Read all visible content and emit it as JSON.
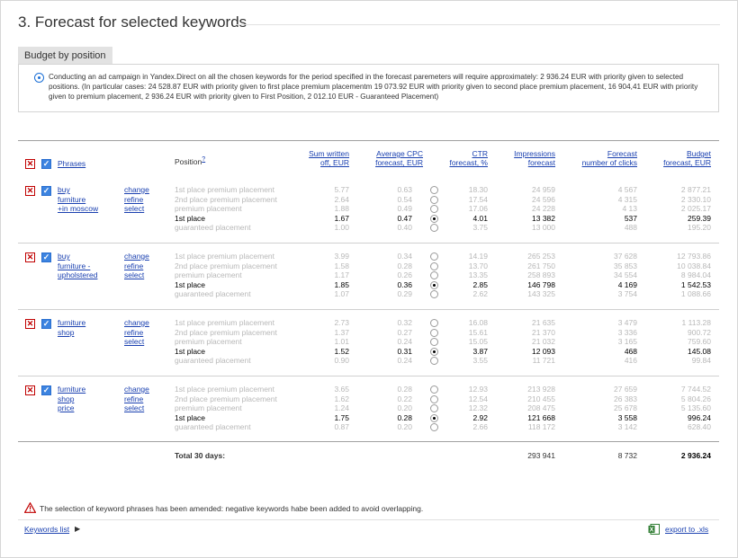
{
  "page": {
    "title": "3. Forecast for selected keywords",
    "tab_label": "Budget by position",
    "info_text": "Conducting an ad campaign in Yandex.Direct on all the chosen keywords for the period specified in the forecast paremeters will require approximately: 2 936.24 EUR with priority given to selected positions. (In particular cases: 24 528.87 EUR with priority given to first place premium placementm 19 073.92 EUR with priority given to second place premium placement, 16 904,41 EUR with priority given to premium placement, 2 936.24 EUR with priority given to First Position, 2 012.10 EUR - Guaranteed Placement)"
  },
  "table": {
    "headers": {
      "phrases": "Phrases",
      "position": "Position",
      "position_help": "?",
      "sum_written": [
        "Sum written",
        "off, EUR"
      ],
      "avg_cpc": [
        "Average CPC",
        "forecast, EUR"
      ],
      "ctr": [
        "CTR",
        "forecast, %"
      ],
      "impressions": [
        "Impressions",
        "forecast"
      ],
      "clicks": [
        "Forecast",
        "number of clicks"
      ],
      "budget": [
        "Budget",
        "forecast, EUR"
      ]
    },
    "action_links": [
      "change",
      "refine",
      "select"
    ],
    "groups": [
      {
        "phrase": [
          "buy",
          "furniture",
          "+in moscow"
        ],
        "rows": [
          {
            "pos": "1st place premium placement",
            "sum": "5.77",
            "cpc": "0.63",
            "ctr": "18.30",
            "imp": "24 959",
            "clicks": "4 567",
            "budget": "2 877.21",
            "selected": false
          },
          {
            "pos": "2nd place premium placement",
            "sum": "2.64",
            "cpc": "0.54",
            "ctr": "17.54",
            "imp": "24 596",
            "clicks": "4 315",
            "budget": "2 330.10",
            "selected": false
          },
          {
            "pos": "premium placement",
            "sum": "1.88",
            "cpc": "0.49",
            "ctr": "17.06",
            "imp": "24 228",
            "clicks": "4 13",
            "budget": "2 025.17",
            "selected": false
          },
          {
            "pos": "1st place",
            "sum": "1.67",
            "cpc": "0.47",
            "ctr": "4.01",
            "imp": "13 382",
            "clicks": "537",
            "budget": "259.39",
            "selected": true
          },
          {
            "pos": "guaranteed placement",
            "sum": "1.00",
            "cpc": "0.40",
            "ctr": "3.75",
            "imp": "13 000",
            "clicks": "488",
            "budget": "195.20",
            "selected": false
          }
        ]
      },
      {
        "phrase": [
          "buy",
          "furniture -",
          "upholstered"
        ],
        "rows": [
          {
            "pos": "1st place premium placement",
            "sum": "3.99",
            "cpc": "0.34",
            "ctr": "14.19",
            "imp": "265 253",
            "clicks": "37 628",
            "budget": "12 793.86",
            "selected": false
          },
          {
            "pos": "2nd place premium placement",
            "sum": "1.58",
            "cpc": "0.28",
            "ctr": "13.70",
            "imp": "261 750",
            "clicks": "35 853",
            "budget": "10 038.84",
            "selected": false
          },
          {
            "pos": "premium placement",
            "sum": "1.17",
            "cpc": "0.26",
            "ctr": "13.35",
            "imp": "258 893",
            "clicks": "34 554",
            "budget": "8 984.04",
            "selected": false
          },
          {
            "pos": "1st place",
            "sum": "1.85",
            "cpc": "0.36",
            "ctr": "2.85",
            "imp": "146 798",
            "clicks": "4 169",
            "budget": "1 542.53",
            "selected": true
          },
          {
            "pos": "guaranteed placement",
            "sum": "1.07",
            "cpc": "0.29",
            "ctr": "2.62",
            "imp": "143 325",
            "clicks": "3 754",
            "budget": "1 088.66",
            "selected": false
          }
        ]
      },
      {
        "phrase": [
          "furniture",
          "shop"
        ],
        "rows": [
          {
            "pos": "1st place premium placement",
            "sum": "2.73",
            "cpc": "0.32",
            "ctr": "16.08",
            "imp": "21 635",
            "clicks": "3 479",
            "budget": "1 113.28",
            "selected": false
          },
          {
            "pos": "2nd place premium placement",
            "sum": "1.37",
            "cpc": "0.27",
            "ctr": "15.61",
            "imp": "21 370",
            "clicks": "3 336",
            "budget": "900.72",
            "selected": false
          },
          {
            "pos": "premium placement",
            "sum": "1.01",
            "cpc": "0.24",
            "ctr": "15.05",
            "imp": "21 032",
            "clicks": "3 165",
            "budget": "759.60",
            "selected": false
          },
          {
            "pos": "1st place",
            "sum": "1.52",
            "cpc": "0.31",
            "ctr": "3.87",
            "imp": "12 093",
            "clicks": "468",
            "budget": "145.08",
            "selected": true
          },
          {
            "pos": "guaranteed placement",
            "sum": "0.90",
            "cpc": "0.24",
            "ctr": "3.55",
            "imp": "11 721",
            "clicks": "416",
            "budget": "99.84",
            "selected": false
          }
        ]
      },
      {
        "phrase": [
          "furniture",
          "shop",
          "price"
        ],
        "rows": [
          {
            "pos": "1st place premium placement",
            "sum": "3.65",
            "cpc": "0.28",
            "ctr": "12.93",
            "imp": "213 928",
            "clicks": "27 659",
            "budget": "7 744.52",
            "selected": false
          },
          {
            "pos": "2nd place premium placement",
            "sum": "1.62",
            "cpc": "0.22",
            "ctr": "12.54",
            "imp": "210 455",
            "clicks": "26 383",
            "budget": "5 804.26",
            "selected": false
          },
          {
            "pos": "premium placement",
            "sum": "1.24",
            "cpc": "0.20",
            "ctr": "12.32",
            "imp": "208 475",
            "clicks": "25 678",
            "budget": "5 135.60",
            "selected": false
          },
          {
            "pos": "1st place",
            "sum": "1.75",
            "cpc": "0.28",
            "ctr": "2.92",
            "imp": "121 668",
            "clicks": "3 558",
            "budget": "996.24",
            "selected": true
          },
          {
            "pos": "guaranteed placement",
            "sum": "0.87",
            "cpc": "0.20",
            "ctr": "2.66",
            "imp": "118 172",
            "clicks": "3 142",
            "budget": "628.40",
            "selected": false
          }
        ]
      }
    ],
    "total": {
      "label": "Total 30 days:",
      "imp": "293 941",
      "clicks": "8 732",
      "budget": "2 936.24"
    }
  },
  "footer": {
    "warning": "The selection of keyword phrases has been amended: negative keywords habe been added to avoid overlapping.",
    "keywords_link": "Keywords list",
    "export_link": "export to .xls"
  }
}
